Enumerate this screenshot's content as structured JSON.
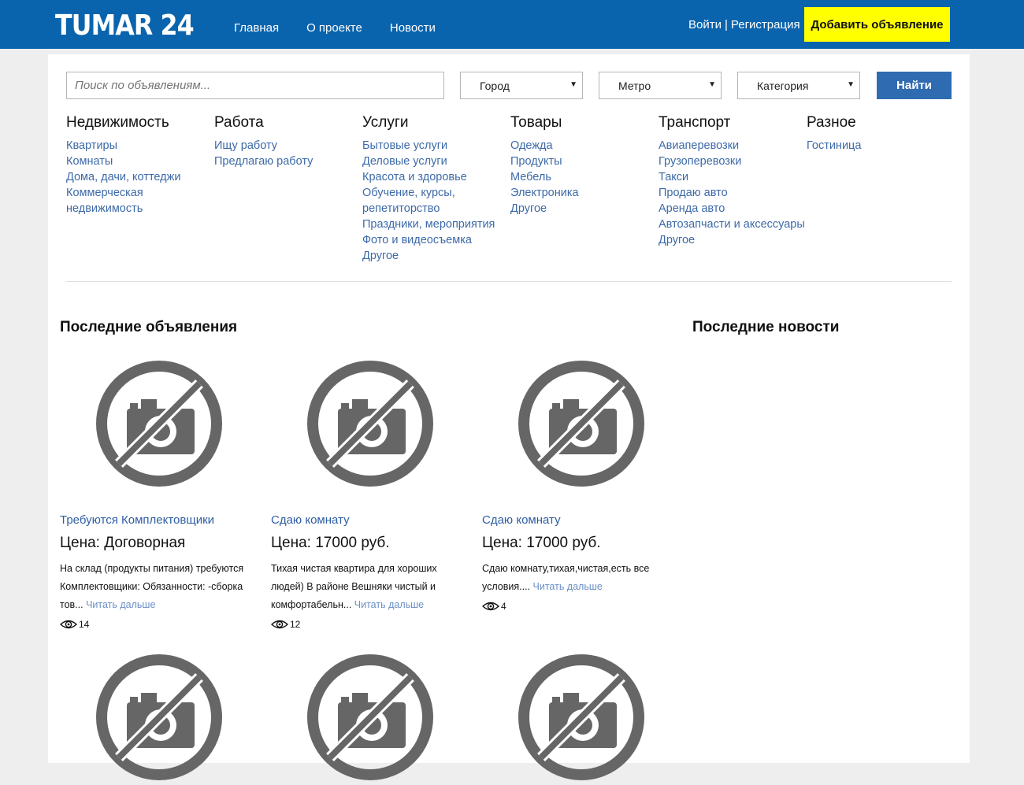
{
  "header": {
    "logo": "TUMAR 24",
    "nav": [
      "Главная",
      "О проекте",
      "Новости"
    ],
    "login": "Войти",
    "separator": "|",
    "register": "Регистрация",
    "add_button": "Добавить объявление",
    "colors": {
      "bar": "#0a64ad",
      "add_button_bg": "#ffff00"
    }
  },
  "search": {
    "placeholder": "Поиск по объявлениям...",
    "city": "Город",
    "metro": "Метро",
    "category": "Категория",
    "button": "Найти"
  },
  "categories": [
    {
      "title": "Недвижимость",
      "links": [
        "Квартиры",
        "Комнаты",
        "Дома, дачи, коттеджи",
        "Коммерческая недвижимость"
      ]
    },
    {
      "title": "Работа",
      "links": [
        "Ищу работу",
        "Предлагаю работу"
      ]
    },
    {
      "title": "Услуги",
      "links": [
        "Бытовые услуги",
        "Деловые услуги",
        "Красота и здоровье",
        "Обучение, курсы, репетиторство",
        "Праздники, мероприятия",
        "Фото и видеосъемка",
        "Другое"
      ]
    },
    {
      "title": "Товары",
      "links": [
        "Одежда",
        "Продукты",
        "Мебель",
        "Электроника",
        "Другое"
      ]
    },
    {
      "title": "Транспорт",
      "links": [
        "Авиаперевозки",
        "Грузоперевозки",
        "Такси",
        "Продаю авто",
        "Аренда авто",
        "Автозапчасти и аксессуары",
        "Другое"
      ]
    },
    {
      "title": "Разное",
      "links": [
        "Гостиница"
      ]
    }
  ],
  "latest_ads_title": "Последние объявления",
  "latest_news_title": "Последние новости",
  "ads": [
    {
      "title": "Требуются Комплектовщики",
      "price": "Цена: Договорная",
      "desc": "На склад (продукты питания) требуются Комплектовщики: Обязанности: -сборка тов...",
      "more": "Читать дальше",
      "views": "14"
    },
    {
      "title": "Сдаю комнату",
      "price": "Цена: 17000 руб.",
      "desc": "Тихая чистая квартира для хороших людей) В районе Вешняки чистый и комфортабельн...",
      "more": "Читать дальше",
      "views": "12"
    },
    {
      "title": "Сдаю комнату",
      "price": "Цена: 17000 руб.",
      "desc": "Сдаю комнату,тихая,чистая,есть все условия....",
      "more": "Читать дальше",
      "views": "4"
    }
  ]
}
